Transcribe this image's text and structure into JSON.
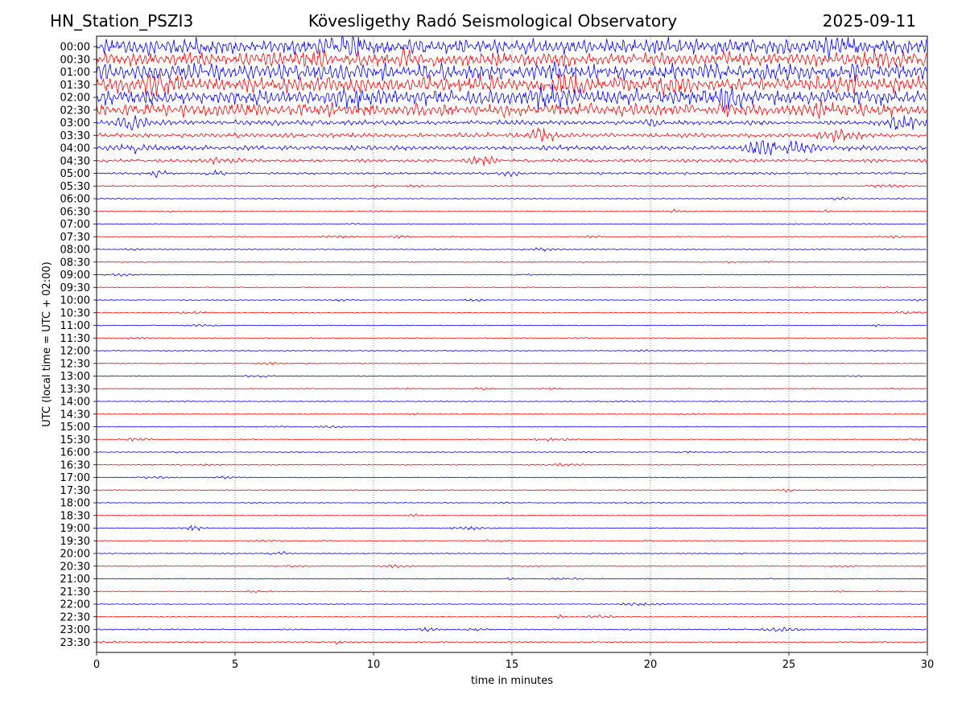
{
  "header": {
    "station": "HN_Station_PSZI3",
    "observatory": "Kövesligethy Radó Seismological Observatory",
    "date": "2025-09-11"
  },
  "chart_data": {
    "type": "line",
    "title": "Kövesligethy Radó Seismological Observatory",
    "xlabel": "time in minutes",
    "ylabel": "UTC (local time = UTC + 02:00)",
    "xlim": [
      0,
      30
    ],
    "xticks": [
      "0",
      "5",
      "10",
      "15",
      "20",
      "25",
      "30"
    ],
    "vertical_gridlines_at": [
      5,
      10,
      15,
      20,
      25
    ],
    "grid": "dotted vertical",
    "series_colors": [
      "#0000ff",
      "#ff0000"
    ],
    "rows": [
      {
        "label": "00:00",
        "level": 1.0
      },
      {
        "label": "00:30",
        "level": 0.85
      },
      {
        "label": "01:00",
        "level": 1.0
      },
      {
        "label": "01:30",
        "level": 1.0
      },
      {
        "label": "02:00",
        "level": 0.95
      },
      {
        "label": "02:30",
        "level": 0.8
      },
      {
        "label": "03:00",
        "level": 0.3
      },
      {
        "label": "03:30",
        "level": 0.28
      },
      {
        "label": "04:00",
        "level": 0.3
      },
      {
        "label": "04:30",
        "level": 0.2
      },
      {
        "label": "05:00",
        "level": 0.15
      },
      {
        "label": "05:30",
        "level": 0.08
      },
      {
        "label": "06:00",
        "level": 0.06
      },
      {
        "label": "06:30",
        "level": 0.05
      },
      {
        "label": "07:00",
        "level": 0.04
      },
      {
        "label": "07:30",
        "level": 0.02
      },
      {
        "label": "08:00",
        "level": 0.02
      },
      {
        "label": "08:30",
        "level": 0.02
      },
      {
        "label": "09:00",
        "level": 0.04
      },
      {
        "label": "09:30",
        "level": 0.04
      },
      {
        "label": "10:00",
        "level": 0.02
      },
      {
        "label": "10:30",
        "level": 0.02
      },
      {
        "label": "11:00",
        "level": 0.04
      },
      {
        "label": "11:30",
        "level": 0.02
      },
      {
        "label": "12:00",
        "level": 0.04
      },
      {
        "label": "12:30",
        "level": 0.03
      },
      {
        "label": "13:00",
        "level": 0.03
      },
      {
        "label": "13:30",
        "level": 0.04
      },
      {
        "label": "14:00",
        "level": 0.04
      },
      {
        "label": "14:30",
        "level": 0.04
      },
      {
        "label": "15:00",
        "level": 0.03
      },
      {
        "label": "15:30",
        "level": 0.05
      },
      {
        "label": "16:00",
        "level": 0.03
      },
      {
        "label": "16:30",
        "level": 0.06
      },
      {
        "label": "17:00",
        "level": 0.03
      },
      {
        "label": "17:30",
        "level": 0.02
      },
      {
        "label": "18:00",
        "level": 0.02
      },
      {
        "label": "18:30",
        "level": 0.02
      },
      {
        "label": "19:00",
        "level": 0.02
      },
      {
        "label": "19:30",
        "level": 0.02
      },
      {
        "label": "20:00",
        "level": 0.03
      },
      {
        "label": "20:30",
        "level": 0.04
      },
      {
        "label": "21:00",
        "level": 0.04
      },
      {
        "label": "21:30",
        "level": 0.04
      },
      {
        "label": "22:00",
        "level": 0.05
      },
      {
        "label": "22:30",
        "level": 0.04
      },
      {
        "label": "23:00",
        "level": 0.08
      },
      {
        "label": "23:30",
        "level": 0.07
      }
    ]
  }
}
